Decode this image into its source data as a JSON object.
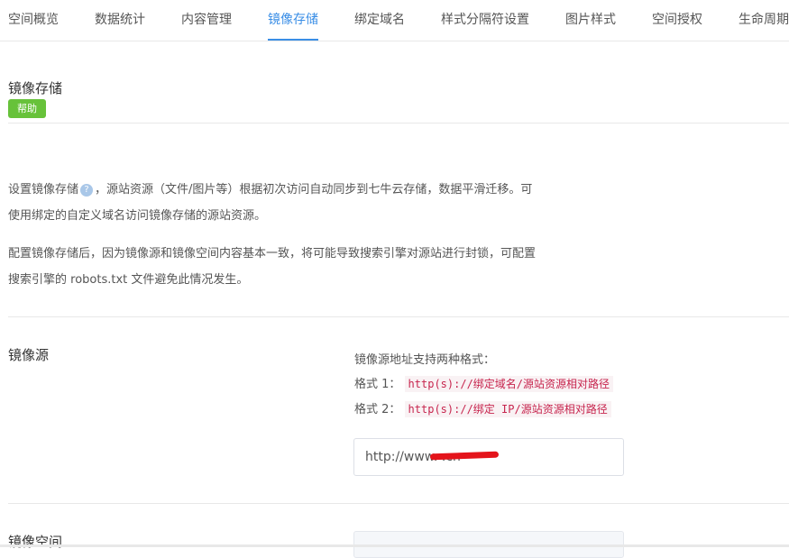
{
  "tabs": [
    {
      "label": "空间概览"
    },
    {
      "label": "数据统计"
    },
    {
      "label": "内容管理"
    },
    {
      "label": "镜像存储",
      "active": true
    },
    {
      "label": "绑定域名"
    },
    {
      "label": "样式分隔符设置"
    },
    {
      "label": "图片样式"
    },
    {
      "label": "空间授权"
    },
    {
      "label": "生命周期"
    }
  ],
  "section": {
    "title": "镜像存储",
    "help_label": "帮助"
  },
  "description": {
    "line1_a": "设置镜像存储",
    "help_icon": "?",
    "line1_b": "，源站资源（文件/图片等）根据初次访问自动同步到七牛云存储，数据平滑迁移。可",
    "line2": "使用绑定的自定义域名访问镜像存储的源站资源。",
    "line3": "配置镜像存储后，因为镜像源和镜像空间内容基本一致，将可能导致搜索引擎对源站进行封锁，可配置",
    "line4": "搜索引擎的 robots.txt 文件避免此情况发生。"
  },
  "mirror_source": {
    "label": "镜像源",
    "hint_title": "镜像源地址支持两种格式：",
    "format1_label": "格式 1：",
    "format1_code": "http(s)://绑定域名/源站资源相对路径",
    "format2_label": "格式 2：",
    "format2_code": "http(s)://绑定 IP/源站资源相对路径",
    "input_value": "http://www.                    .cn"
  },
  "mirror_space": {
    "label": "镜像空间"
  },
  "colors": {
    "accent": "#3a8ee6",
    "help_button": "#67c23a",
    "code_text": "#c7254e",
    "redaction": "#e4141b"
  }
}
